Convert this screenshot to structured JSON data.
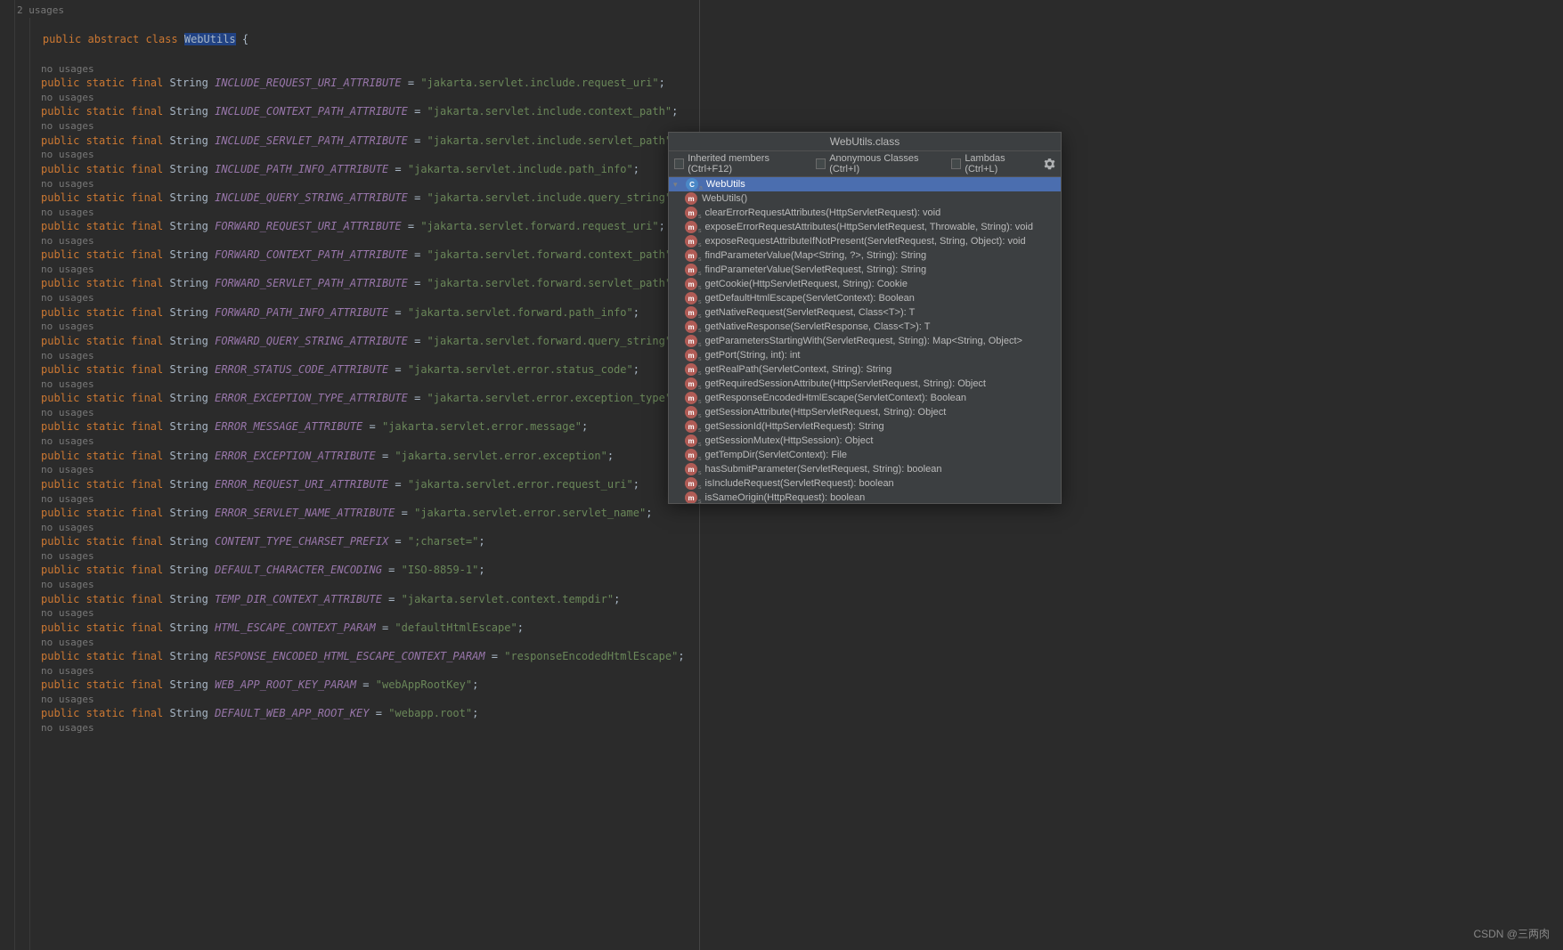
{
  "editor": {
    "usagesTop": "2 usages",
    "noUsages": "no usages",
    "classLine": {
      "mods": "public abstract class",
      "name": "WebUtils",
      "brace": " {"
    },
    "fields": [
      {
        "name": "INCLUDE_REQUEST_URI_ATTRIBUTE",
        "value": "\"jakarta.servlet.include.request_uri\""
      },
      {
        "name": "INCLUDE_CONTEXT_PATH_ATTRIBUTE",
        "value": "\"jakarta.servlet.include.context_path\""
      },
      {
        "name": "INCLUDE_SERVLET_PATH_ATTRIBUTE",
        "value": "\"jakarta.servlet.include.servlet_path\""
      },
      {
        "name": "INCLUDE_PATH_INFO_ATTRIBUTE",
        "value": "\"jakarta.servlet.include.path_info\""
      },
      {
        "name": "INCLUDE_QUERY_STRING_ATTRIBUTE",
        "value": "\"jakarta.servlet.include.query_string\""
      },
      {
        "name": "FORWARD_REQUEST_URI_ATTRIBUTE",
        "value": "\"jakarta.servlet.forward.request_uri\""
      },
      {
        "name": "FORWARD_CONTEXT_PATH_ATTRIBUTE",
        "value": "\"jakarta.servlet.forward.context_path\""
      },
      {
        "name": "FORWARD_SERVLET_PATH_ATTRIBUTE",
        "value": "\"jakarta.servlet.forward.servlet_path\""
      },
      {
        "name": "FORWARD_PATH_INFO_ATTRIBUTE",
        "value": "\"jakarta.servlet.forward.path_info\""
      },
      {
        "name": "FORWARD_QUERY_STRING_ATTRIBUTE",
        "value": "\"jakarta.servlet.forward.query_string\""
      },
      {
        "name": "ERROR_STATUS_CODE_ATTRIBUTE",
        "value": "\"jakarta.servlet.error.status_code\""
      },
      {
        "name": "ERROR_EXCEPTION_TYPE_ATTRIBUTE",
        "value": "\"jakarta.servlet.error.exception_type\""
      },
      {
        "name": "ERROR_MESSAGE_ATTRIBUTE",
        "value": "\"jakarta.servlet.error.message\""
      },
      {
        "name": "ERROR_EXCEPTION_ATTRIBUTE",
        "value": "\"jakarta.servlet.error.exception\""
      },
      {
        "name": "ERROR_REQUEST_URI_ATTRIBUTE",
        "value": "\"jakarta.servlet.error.request_uri\""
      },
      {
        "name": "ERROR_SERVLET_NAME_ATTRIBUTE",
        "value": "\"jakarta.servlet.error.servlet_name\""
      },
      {
        "name": "CONTENT_TYPE_CHARSET_PREFIX",
        "value": "\";charset=\""
      },
      {
        "name": "DEFAULT_CHARACTER_ENCODING",
        "value": "\"ISO-8859-1\""
      },
      {
        "name": "TEMP_DIR_CONTEXT_ATTRIBUTE",
        "value": "\"jakarta.servlet.context.tempdir\""
      },
      {
        "name": "HTML_ESCAPE_CONTEXT_PARAM",
        "value": "\"defaultHtmlEscape\""
      },
      {
        "name": "RESPONSE_ENCODED_HTML_ESCAPE_CONTEXT_PARAM",
        "value": "\"responseEncodedHtmlEscape\""
      },
      {
        "name": "WEB_APP_ROOT_KEY_PARAM",
        "value": "\"webAppRootKey\""
      },
      {
        "name": "DEFAULT_WEB_APP_ROOT_KEY",
        "value": "\"webapp.root\""
      }
    ],
    "fieldPrefix": "public static final",
    "fieldType": "String"
  },
  "popup": {
    "title": "WebUtils.class",
    "toolbar": {
      "inherited": "Inherited members (Ctrl+F12)",
      "anonymous": "Anonymous Classes (Ctrl+I)",
      "lambdas": "Lambdas (Ctrl+L)"
    },
    "root": "WebUtils",
    "members": [
      "WebUtils()",
      "clearErrorRequestAttributes(HttpServletRequest): void",
      "exposeErrorRequestAttributes(HttpServletRequest, Throwable, String): void",
      "exposeRequestAttributeIfNotPresent(ServletRequest, String, Object): void",
      "findParameterValue(Map<String, ?>, String): String",
      "findParameterValue(ServletRequest, String): String",
      "getCookie(HttpServletRequest, String): Cookie",
      "getDefaultHtmlEscape(ServletContext): Boolean",
      "getNativeRequest(ServletRequest, Class<T>): T",
      "getNativeResponse(ServletResponse, Class<T>): T",
      "getParametersStartingWith(ServletRequest, String): Map<String, Object>",
      "getPort(String, int): int",
      "getRealPath(ServletContext, String): String",
      "getRequiredSessionAttribute(HttpServletRequest, String): Object",
      "getResponseEncodedHtmlEscape(ServletContext): Boolean",
      "getSessionAttribute(HttpServletRequest, String): Object",
      "getSessionId(HttpServletRequest): String",
      "getSessionMutex(HttpSession): Object",
      "getTempDir(ServletContext): File",
      "hasSubmitParameter(ServletRequest, String): boolean",
      "isIncludeRequest(ServletRequest): boolean",
      "isSameOrigin(HttpRequest): boolean"
    ]
  },
  "watermark": "CSDN @三两肉"
}
